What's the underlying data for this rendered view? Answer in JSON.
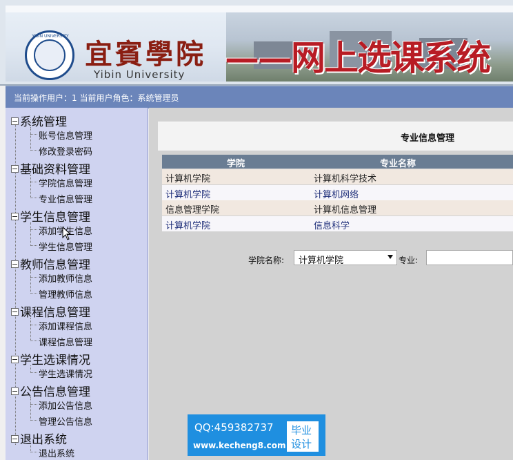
{
  "banner": {
    "school_name_cn": "宜賓學院",
    "school_name_en": "Yibin University",
    "logo_text": "YIBIN UNIVERSITY",
    "system_title": "——网上选课系统"
  },
  "status": {
    "text": "当前操作用户：1 当前用户角色：系统管理员"
  },
  "sidebar": {
    "groups": [
      {
        "label": "系统管理",
        "items": [
          "账号信息管理",
          "修改登录密码"
        ]
      },
      {
        "label": "基础资料管理",
        "items": [
          "学院信息管理",
          "专业信息管理"
        ]
      },
      {
        "label": "学生信息管理",
        "items": [
          "添加学生信息",
          "学生信息管理"
        ]
      },
      {
        "label": "教师信息管理",
        "items": [
          "添加教师信息",
          "管理教师信息"
        ]
      },
      {
        "label": "课程信息管理",
        "items": [
          "添加课程信息",
          "课程信息管理"
        ]
      },
      {
        "label": "学生选课情况",
        "items": [
          "学生选课情况"
        ]
      },
      {
        "label": "公告信息管理",
        "items": [
          "添加公告信息",
          "管理公告信息"
        ]
      },
      {
        "label": "退出系统",
        "items": [
          "退出系统"
        ]
      }
    ]
  },
  "main": {
    "title": "专业信息管理",
    "table": {
      "columns": [
        "学院",
        "专业名称"
      ],
      "rows": [
        [
          "计算机学院",
          "计算机科学技术"
        ],
        [
          "计算机学院",
          "计算机网络"
        ],
        [
          "信息管理学院",
          "计算机信息管理"
        ],
        [
          "计算机学院",
          "信息科学"
        ]
      ]
    },
    "filter": {
      "college_label": "学院名称:",
      "college_value": "计算机学院",
      "major_label": "专业:",
      "major_value": ""
    }
  },
  "watermark": {
    "qq": "QQ:459382737",
    "url": "www.kecheng8.com",
    "badge_line1": "毕业",
    "badge_line2": "设计"
  },
  "colors": {
    "status_bar": "#6b85ba",
    "sidebar_bg": "#cfd3f0",
    "table_header": "#6a7d93",
    "title_red": "#b81c24"
  }
}
